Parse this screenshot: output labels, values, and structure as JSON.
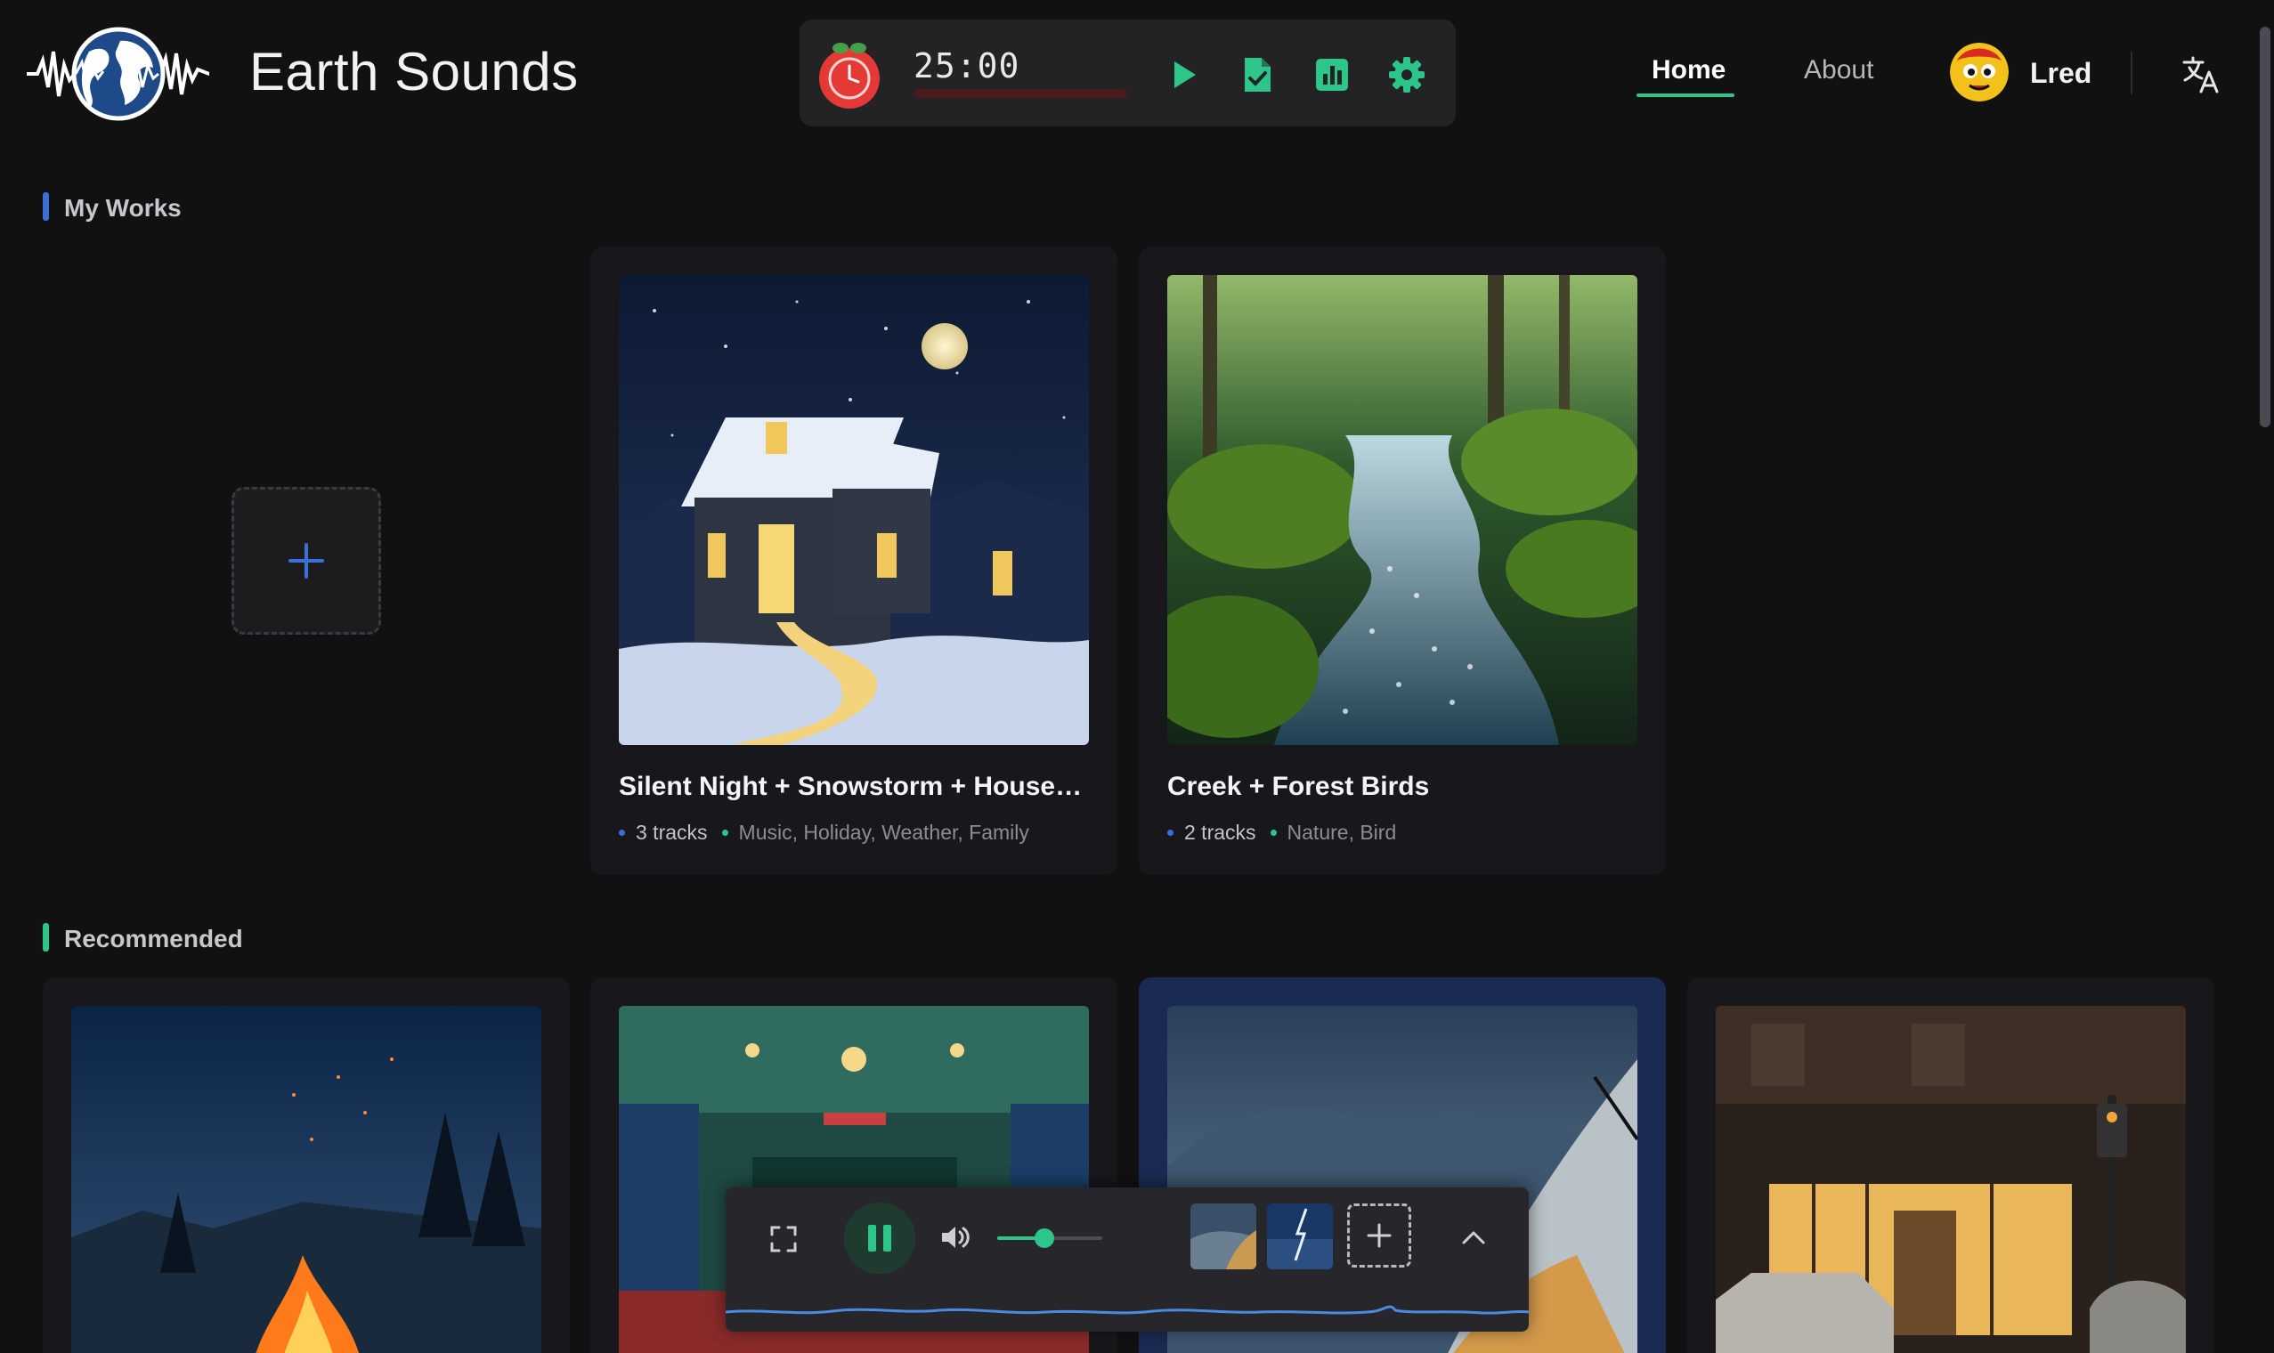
{
  "app": {
    "title": "Earth Sounds"
  },
  "timer": {
    "time": "25:00"
  },
  "nav": {
    "home": "Home",
    "about": "About"
  },
  "user": {
    "name": "Lred"
  },
  "sections": {
    "my_works": "My Works",
    "recommended": "Recommended"
  },
  "works": [
    {
      "title": "Silent Night + Snowstorm + Househo...",
      "tracks": "3 tracks",
      "tags": "Music, Holiday, Weather, Family"
    },
    {
      "title": "Creek + Forest Birds",
      "tracks": "2 tracks",
      "tags": "Nature, Bird"
    }
  ],
  "player": {
    "volume": 0.45
  },
  "colors": {
    "accent": "#2ec58a",
    "my_works_bar": "#3b6fd8",
    "recommended_bar": "#2ec58a",
    "active_card": "#1a2a52"
  }
}
